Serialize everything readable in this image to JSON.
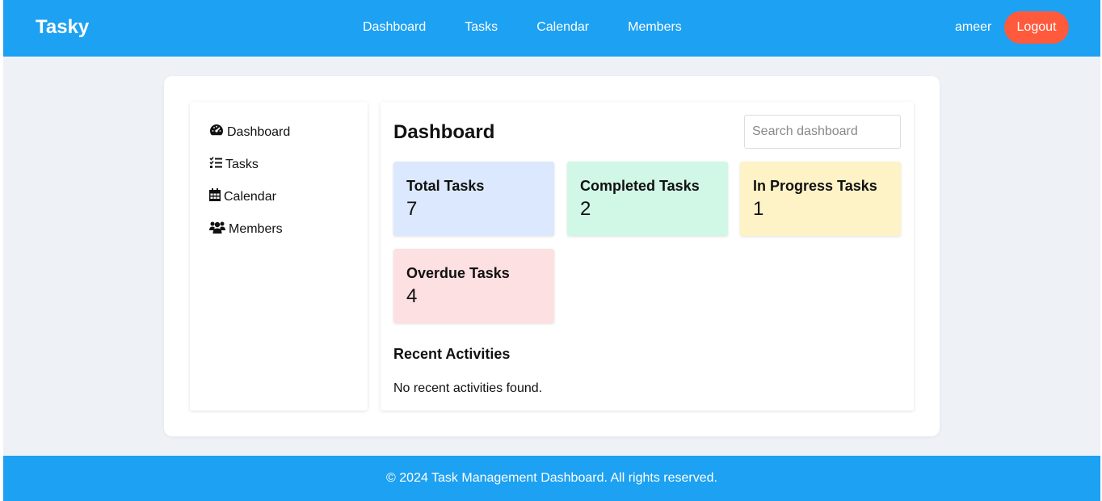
{
  "navbar": {
    "brand": "Tasky",
    "links": [
      "Dashboard",
      "Tasks",
      "Calendar",
      "Members"
    ],
    "username": "ameer",
    "logout_label": "Logout",
    "bg_color": "#1da1f2",
    "logout_color": "#ff5a3c"
  },
  "sidebar": {
    "items": [
      {
        "label": "Dashboard",
        "icon": "gauge-icon"
      },
      {
        "label": "Tasks",
        "icon": "checklist-icon"
      },
      {
        "label": "Calendar",
        "icon": "calendar-icon"
      },
      {
        "label": "Members",
        "icon": "users-icon"
      }
    ]
  },
  "main": {
    "title": "Dashboard",
    "search_placeholder": "Search dashboard",
    "search_value": "",
    "cards": [
      {
        "title": "Total Tasks",
        "value": "7",
        "color": "#dbe8fd"
      },
      {
        "title": "Completed Tasks",
        "value": "2",
        "color": "#d1f7e6"
      },
      {
        "title": "In Progress Tasks",
        "value": "1",
        "color": "#fef3c7"
      },
      {
        "title": "Overdue Tasks",
        "value": "4",
        "color": "#fde0e1"
      }
    ],
    "recent_title": "Recent Activities",
    "recent_empty": "No recent activities found."
  },
  "footer": {
    "text": "© 2024 Task Management Dashboard. All rights reserved."
  }
}
